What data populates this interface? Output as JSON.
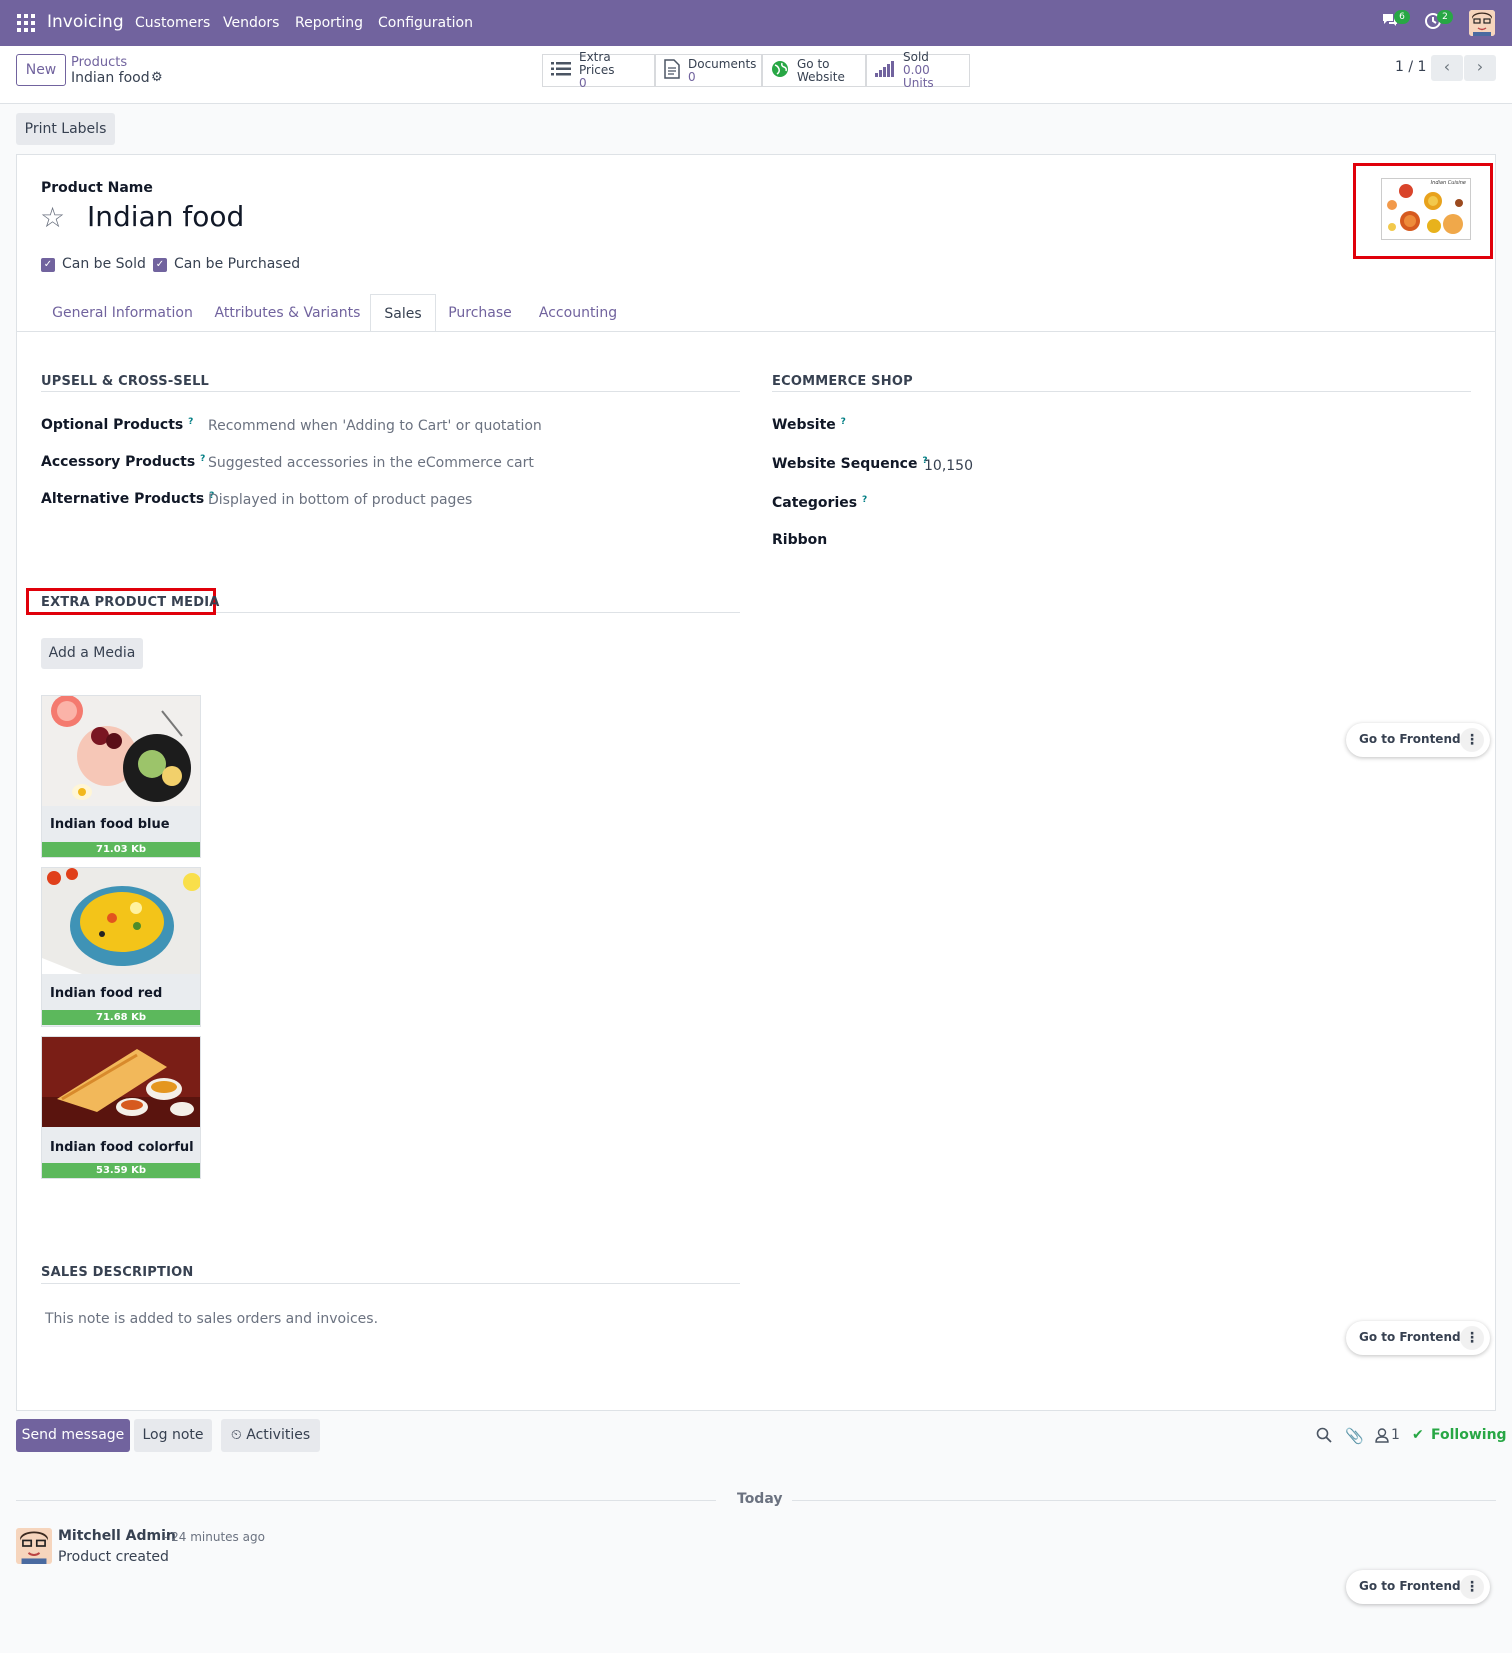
{
  "navbar": {
    "app_name": "Invoicing",
    "menu": [
      "Customers",
      "Vendors",
      "Reporting",
      "Configuration"
    ],
    "messages_count": "6",
    "activities_count": "2"
  },
  "control_panel": {
    "new_label": "New",
    "breadcrumb_parent": "Products",
    "breadcrumb_current": "Indian food",
    "stats": [
      {
        "label": "Extra Prices",
        "value": "0",
        "icon": "list-icon"
      },
      {
        "label": "Documents",
        "value": "0",
        "icon": "document-icon"
      },
      {
        "label": "Go to",
        "value": "Website",
        "icon": "globe-icon"
      },
      {
        "label": "Sold",
        "value": "0.00 Units",
        "icon": "signal-icon"
      }
    ],
    "pager": "1 / 1"
  },
  "actions": {
    "print_labels": "Print Labels"
  },
  "product": {
    "name_label": "Product Name",
    "name": "Indian food",
    "can_be_sold": "Can be Sold",
    "can_be_purchased": "Can be Purchased",
    "image_caption": "Indian Cuisine"
  },
  "tabs": [
    "General Information",
    "Attributes & Variants",
    "Sales",
    "Purchase",
    "Accounting"
  ],
  "active_tab": "Sales",
  "upsell": {
    "title": "UPSELL & CROSS-SELL",
    "fields": [
      {
        "label": "Optional Products",
        "placeholder": "Recommend when 'Adding to Cart' or quotation"
      },
      {
        "label": "Accessory Products",
        "placeholder": "Suggested accessories in the eCommerce cart"
      },
      {
        "label": "Alternative Products",
        "placeholder": "Displayed in bottom of product pages"
      }
    ]
  },
  "ecommerce": {
    "title": "ECOMMERCE SHOP",
    "website_label": "Website",
    "sequence_label": "Website Sequence",
    "sequence_value": "10,150",
    "categories_label": "Categories",
    "ribbon_label": "Ribbon"
  },
  "extra_media": {
    "title": "EXTRA PRODUCT MEDIA",
    "add_label": "Add a Media",
    "items": [
      {
        "name": "Indian food blue",
        "size": "71.03 Kb"
      },
      {
        "name": "Indian food red",
        "size": "71.68 Kb"
      },
      {
        "name": "Indian food colorful",
        "size": "53.59 Kb"
      }
    ]
  },
  "sales_description": {
    "title": "SALES DESCRIPTION",
    "placeholder": "This note is added to sales orders and invoices."
  },
  "go_to_frontend": "Go to Frontend",
  "chatter": {
    "send_message": "Send message",
    "log_note": "Log note",
    "activities": "Activities",
    "followers_count": "1",
    "following": "Following",
    "date_separator": "Today",
    "message": {
      "author": "Mitchell Admin",
      "time": "- 24 minutes ago",
      "body": "Product created"
    }
  },
  "colors": {
    "brand": "#71639e",
    "success": "#28a745",
    "highlight": "#e0000a"
  }
}
